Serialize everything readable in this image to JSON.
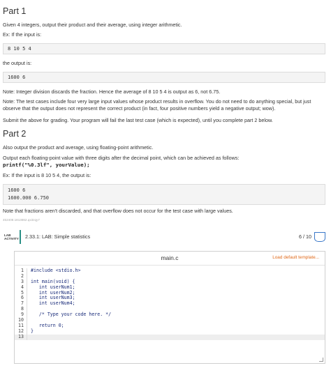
{
  "part1": {
    "heading": "Part 1",
    "intro": "Given 4 integers, output their product and their average, using integer arithmetic.",
    "ex_label": "Ex: If the input is:",
    "input_example": "8 10 5 4",
    "output_label": "the output is:",
    "output_example": "1600 6",
    "note1": "Note: Integer division discards the fraction. Hence the average of 8 10 5 4 is output as 6, not 6.75.",
    "note2": "Note: The test cases include four very large input values whose product results in overflow. You do not need to do anything special, but just observe that the output does not represent the correct product (in fact, four positive numbers yield a negative output; wow).",
    "submit_text": "Submit the above for grading. Your program will fail the last test case (which is expected), until you complete part 2 below."
  },
  "part2": {
    "heading": "Part 2",
    "intro": "Also output the product and average, using floating-point arithmetic.",
    "format_text": "Output each floating-point value with three digits after the decimal point, which can be achieved as follows:",
    "printf_code": "printf(\"%0.3lf\", yourValue);",
    "ex_text": "Ex: If the input is 8 10 5 4, the output is:",
    "output_line1": "1600 6",
    "output_line2": "1600.000 6.750",
    "note": "Note that fractions aren't discarded, and that overflow does not occur for the test case with large values.",
    "id_note": "452408.1813862.qx3zqy7"
  },
  "activity": {
    "tag_line1": "LAB",
    "tag_line2": "ACTIVITY",
    "title": "2.33.1: LAB: Simple statistics",
    "score": "6 / 10"
  },
  "editor": {
    "file_name": "main.c",
    "load_link": "Load default template...",
    "lines": [
      {
        "n": "1",
        "code": "#include <stdio.h>"
      },
      {
        "n": "2",
        "code": ""
      },
      {
        "n": "3",
        "code": "int main(void) {"
      },
      {
        "n": "4",
        "code": "   int userNum1;"
      },
      {
        "n": "5",
        "code": "   int userNum2;"
      },
      {
        "n": "6",
        "code": "   int userNum3;"
      },
      {
        "n": "7",
        "code": "   int userNum4;"
      },
      {
        "n": "8",
        "code": ""
      },
      {
        "n": "9",
        "code": "   /* Type your code here. */"
      },
      {
        "n": "10",
        "code": ""
      },
      {
        "n": "11",
        "code": "   return 0;"
      },
      {
        "n": "12",
        "code": "}"
      },
      {
        "n": "13",
        "code": ""
      }
    ]
  }
}
